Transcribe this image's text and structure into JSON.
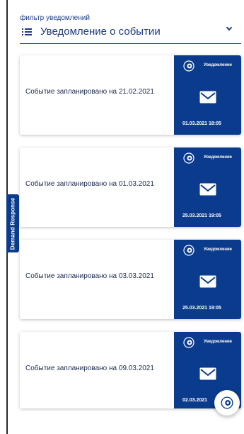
{
  "side_tab": {
    "label": "Demand Response"
  },
  "filter": {
    "label": "фильтр уведомлений",
    "selected": "Уведомление о событии"
  },
  "icons": {
    "filter_list": "list-icon",
    "dropdown": "chevron-down-icon",
    "brand": "gear-logo-icon",
    "mail": "envelope-icon"
  },
  "colors": {
    "accent": "#0b3b8c",
    "text": "#1e3a84"
  },
  "cards": [
    {
      "text": "Событие запланировано на 21.02.2021",
      "badge": "Уведомление",
      "time": "01.03.2021 18:05"
    },
    {
      "text": "Событие запланировано на 01.03.2021",
      "badge": "Уведомление",
      "time": "25.03.2021 19:05"
    },
    {
      "text": "Событие запланировано на 03.03.2021",
      "badge": "Уведомление",
      "time": "25.03.2021 19:05"
    },
    {
      "text": "Событие запланировано на 09.03.2021",
      "badge": "Уведомление",
      "time": "02.03.2021"
    }
  ]
}
